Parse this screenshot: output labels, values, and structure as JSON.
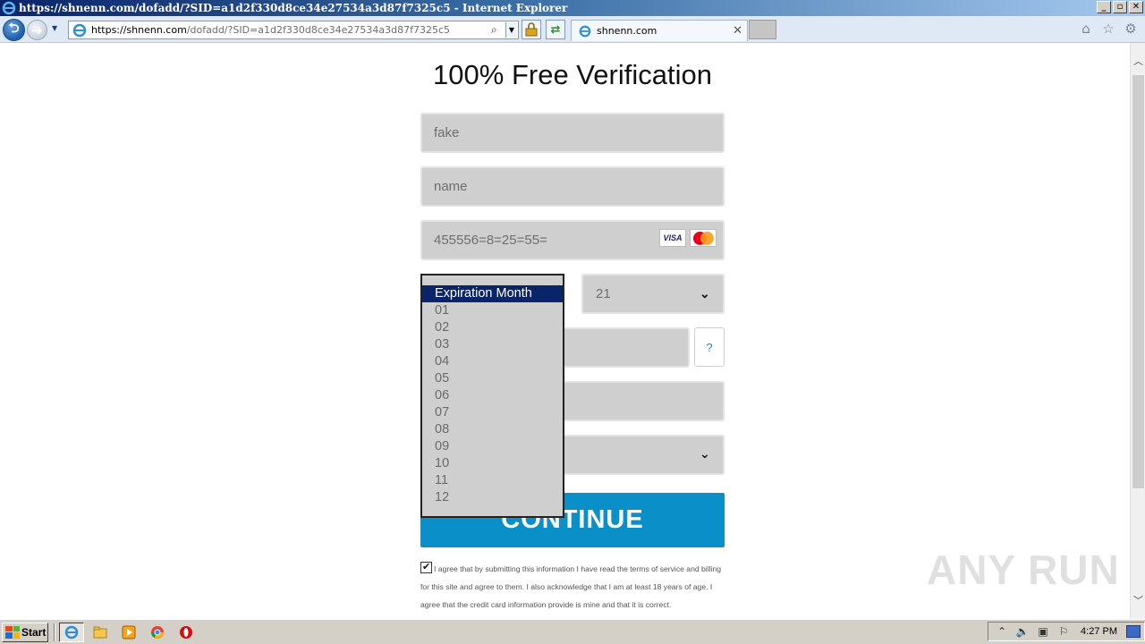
{
  "window": {
    "title": "https://shnenn.com/dofadd/?SID=a1d2f330d8ce34e27534a3d87f7325c5 - Internet Explorer",
    "buttons": [
      "_",
      "▫",
      "✕"
    ]
  },
  "navbar": {
    "address_domain": "https://shnenn.com",
    "address_path": "/dofadd/?SID=a1d2f330d8ce34e27534a3d87f7325c5",
    "tab_label": "shnenn.com"
  },
  "page": {
    "heading": "100% Free Verification",
    "first_name": "fake",
    "last_name": "name",
    "card_number": "455556=8=25=55=",
    "visa_label": "VISA",
    "year_value": "21",
    "help_label": "?",
    "continue_label": "CONTINUE",
    "agree_text": "I agree that by submitting this information I have read the terms of service and billing for this site and agree to them. I also acknowledge that I am at least 18 years of age. I agree that the credit card information provide is mine and that it is correct."
  },
  "month_dropdown": {
    "selected": "Expiration Month",
    "options": [
      "01",
      "02",
      "03",
      "04",
      "05",
      "06",
      "07",
      "08",
      "09",
      "10",
      "11",
      "12"
    ]
  },
  "watermark": "ANY RUN",
  "taskbar": {
    "start_label": "Start",
    "clock": "4:27 PM"
  }
}
